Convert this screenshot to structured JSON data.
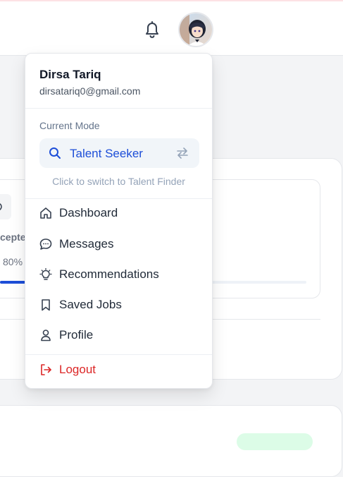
{
  "header": {
    "notifications_icon": "bell-icon",
    "avatar": "user-avatar"
  },
  "background": {
    "stat_label": "cepte",
    "stat_percent": "80%"
  },
  "menu": {
    "user": {
      "name": "Dirsa Tariq",
      "email": "dirsatariq0@gmail.com"
    },
    "mode": {
      "label": "Current Mode",
      "current": "Talent Seeker",
      "hint": "Click to switch to Talent Finder",
      "accent": "#1d4ed8"
    },
    "items": [
      {
        "label": "Dashboard",
        "icon": "home-icon"
      },
      {
        "label": "Messages",
        "icon": "chat-icon"
      },
      {
        "label": "Recommendations",
        "icon": "lightbulb-icon"
      },
      {
        "label": "Saved Jobs",
        "icon": "bookmark-icon"
      },
      {
        "label": "Profile",
        "icon": "user-icon"
      }
    ],
    "logout": {
      "label": "Logout",
      "icon": "logout-icon",
      "color": "#dc2626"
    }
  }
}
